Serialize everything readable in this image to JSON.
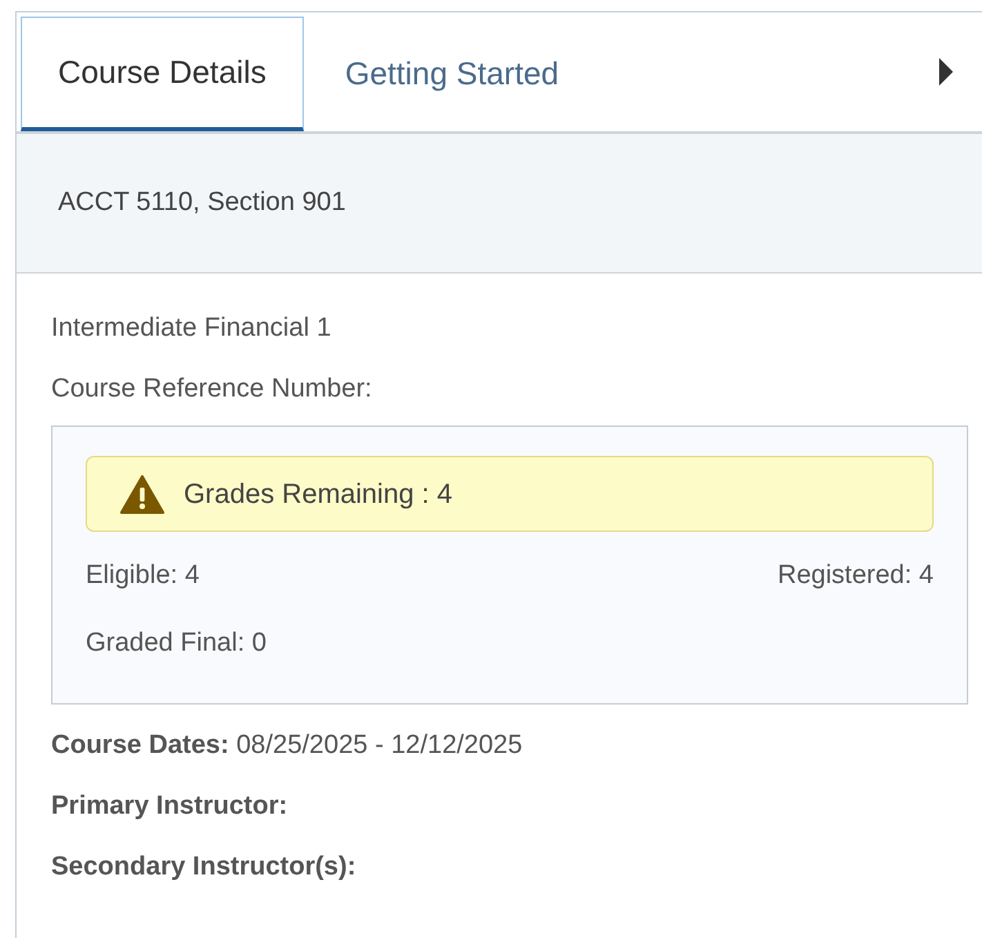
{
  "tabs": [
    {
      "label": "Course Details",
      "selected": true
    },
    {
      "label": "Getting Started",
      "selected": false
    }
  ],
  "header": {
    "title": "ACCT 5110, Section 901"
  },
  "course": {
    "name": "Intermediate Financial 1",
    "crn_label": "Course Reference Number:"
  },
  "grades": {
    "alert": "Grades Remaining : 4",
    "eligible": "Eligible: 4",
    "registered": "Registered: 4",
    "graded_final": "Graded Final: 0"
  },
  "details": [
    {
      "label": "Course Dates:",
      "value": "08/25/2025 - 12/12/2025"
    },
    {
      "label": "Primary Instructor:"
    },
    {
      "label": "Secondary Instructor(s):"
    }
  ]
}
